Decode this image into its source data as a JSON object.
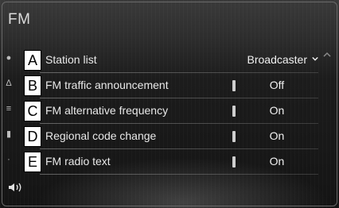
{
  "screen": {
    "title": "FM"
  },
  "rows": [
    {
      "letter": "A",
      "label": "Station list",
      "value": "Broadcaster"
    },
    {
      "letter": "B",
      "label": "FM traffic announcement",
      "value": "Off"
    },
    {
      "letter": "C",
      "label": "FM alternative frequency",
      "value": "On"
    },
    {
      "letter": "D",
      "label": "Regional code change",
      "value": "On"
    },
    {
      "letter": "E",
      "label": "FM radio text",
      "value": "On"
    }
  ],
  "icons": {
    "dropdown": "chevron-down-icon",
    "scroll": "scroll-up-icon",
    "volume": "speaker-icon"
  }
}
